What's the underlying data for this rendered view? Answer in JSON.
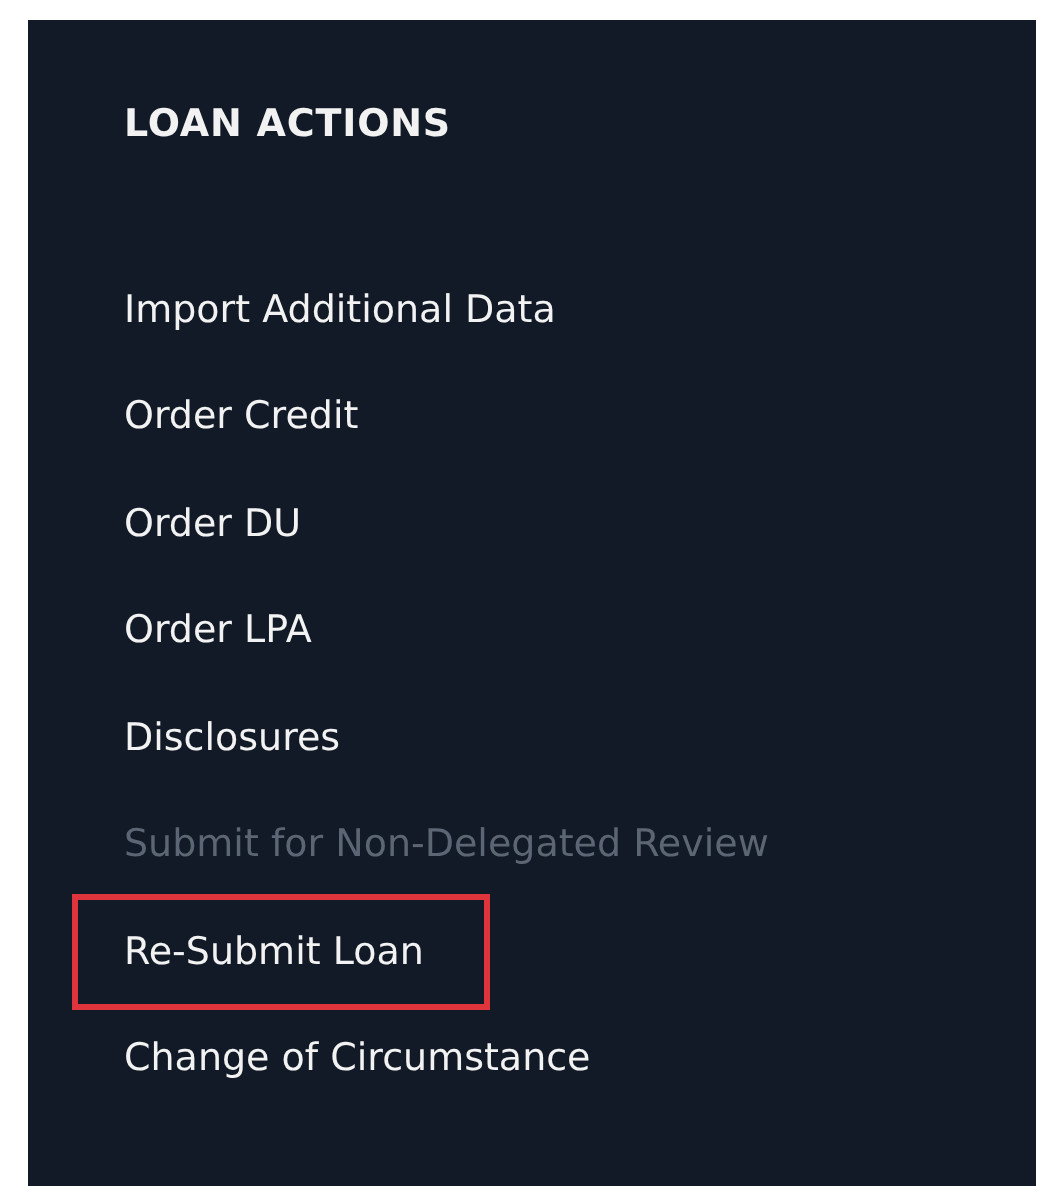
{
  "panel": {
    "title": "LOAN ACTIONS",
    "items": [
      {
        "label": "Import Additional Data",
        "disabled": false,
        "highlighted": false
      },
      {
        "label": "Order Credit",
        "disabled": false,
        "highlighted": false
      },
      {
        "label": "Order DU",
        "disabled": false,
        "highlighted": false
      },
      {
        "label": "Order LPA",
        "disabled": false,
        "highlighted": false
      },
      {
        "label": "Disclosures",
        "disabled": false,
        "highlighted": false
      },
      {
        "label": "Submit for Non-Delegated Review",
        "disabled": true,
        "highlighted": false
      },
      {
        "label": "Re-Submit Loan",
        "disabled": false,
        "highlighted": true
      },
      {
        "label": "Change of Circumstance",
        "disabled": false,
        "highlighted": false
      }
    ]
  }
}
